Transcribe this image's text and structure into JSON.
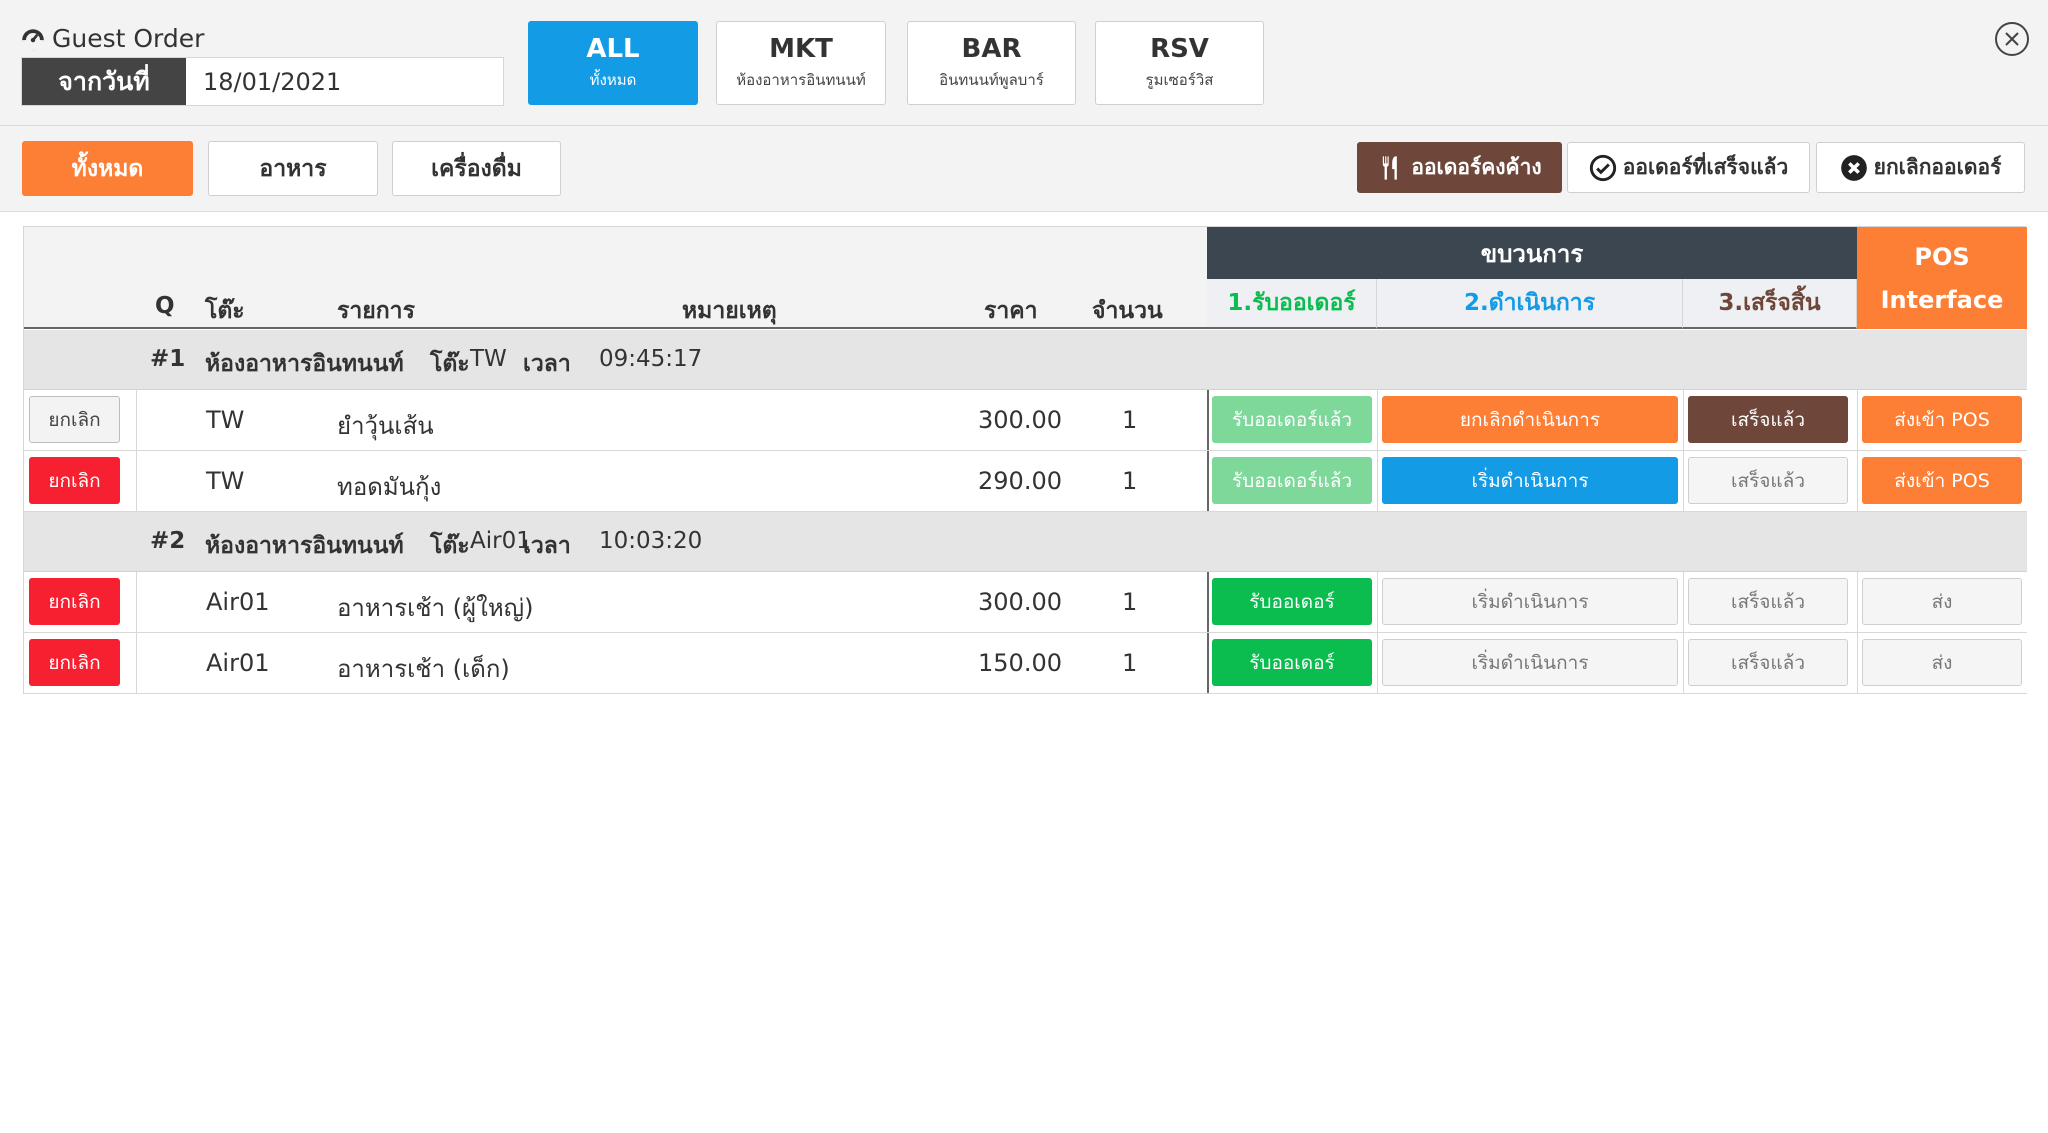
{
  "header": {
    "title": "Guest Order",
    "date_label": "จากวันที่",
    "date_value": "18/01/2021",
    "outlets": [
      {
        "code": "ALL",
        "name": "ทั้งหมด",
        "active": true
      },
      {
        "code": "MKT",
        "name": "ห้องอาหารอินทนนท์",
        "active": false
      },
      {
        "code": "BAR",
        "name": "อินทนนท์พูลบาร์",
        "active": false
      },
      {
        "code": "RSV",
        "name": "รูมเซอร์วิส",
        "active": false
      }
    ]
  },
  "filters": {
    "category": [
      "ทั้งหมด",
      "อาหาร",
      "เครื่องดื่ม"
    ],
    "active_category": "ทั้งหมด",
    "status_pending": "ออเดอร์คงค้าง",
    "status_done": "ออเดอร์ที่เสร็จแล้ว",
    "status_cancelled": "ยกเลิกออเดอร์"
  },
  "table": {
    "columns": {
      "q": "Q",
      "table": "โต๊ะ",
      "item": "รายการ",
      "note": "หมายเหตุ",
      "price": "ราคา",
      "qty": "จำนวน"
    },
    "process_title": "ขบวนการ",
    "process_steps": [
      "1.รับออเดอร์",
      "2.ดำเนินการ",
      "3.เสร็จสิ้น"
    ],
    "pos_header": [
      "POS",
      "Interface"
    ],
    "group_labels": {
      "table": "โต๊ะ",
      "time": "เวลา"
    },
    "groups": [
      {
        "q": "#1",
        "outlet": "ห้องอาหารอินทนนท์",
        "table": "TW",
        "time": "09:45:17",
        "items": [
          {
            "cancel": "ยกเลิก",
            "cancel_enabled": false,
            "table": "TW",
            "name": "ยำวุ้นเส้น",
            "note": "",
            "price": "300.00",
            "qty": "1",
            "step1": "รับออเดอร์แล้ว",
            "step2": "ยกเลิกดำเนินการ",
            "step3": "เสร็จแล้ว",
            "pos": "ส่งเข้า POS"
          },
          {
            "cancel": "ยกเลิก",
            "cancel_enabled": true,
            "table": "TW",
            "name": "ทอดมันกุ้ง",
            "note": "",
            "price": "290.00",
            "qty": "1",
            "step1": "รับออเดอร์แล้ว",
            "step2": "เริ่มดำเนินการ",
            "step3": "เสร็จแล้ว",
            "pos": "ส่งเข้า POS"
          }
        ]
      },
      {
        "q": "#2",
        "outlet": "ห้องอาหารอินทนนท์",
        "table": "Air01",
        "time": "10:03:20",
        "items": [
          {
            "cancel": "ยกเลิก",
            "cancel_enabled": true,
            "table": "Air01",
            "name": "อาหารเช้า (ผู้ใหญ่)",
            "note": "",
            "price": "300.00",
            "qty": "1",
            "step1": "รับออเดอร์",
            "step2": "เริ่มดำเนินการ",
            "step3": "เสร็จแล้ว",
            "pos": "ส่ง"
          },
          {
            "cancel": "ยกเลิก",
            "cancel_enabled": true,
            "table": "Air01",
            "name": "อาหารเช้า (เด็ก)",
            "note": "",
            "price": "150.00",
            "qty": "1",
            "step1": "รับออเดอร์",
            "step2": "เริ่มดำเนินการ",
            "step3": "เสร็จแล้ว",
            "pos": "ส่ง"
          }
        ]
      }
    ]
  },
  "colors": {
    "accent_blue": "#139be6",
    "accent_orange": "#fd7f36",
    "accent_brown": "#6e463a",
    "success_green": "#0bbd4f",
    "danger_red": "#f72031",
    "header_dark": "#3b4650"
  }
}
